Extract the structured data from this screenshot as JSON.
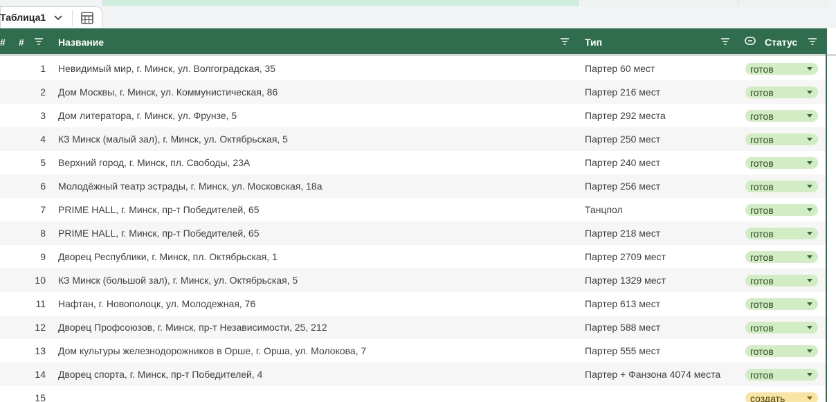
{
  "sheet_tab": {
    "name": "Таблица1"
  },
  "columns": {
    "hash1": "#",
    "hash2": "#",
    "name": "Название",
    "type": "Тип",
    "status": "Статус"
  },
  "rows": [
    {
      "num": "1",
      "name": "Невидимый мир, г. Минск, ул. Волгоградская, 35",
      "type": "Партер 60 мест",
      "status": "готов"
    },
    {
      "num": "2",
      "name": "Дом Москвы, г. Минск, ул. Коммунистическая, 86",
      "type": "Партер 216 мест",
      "status": "готов"
    },
    {
      "num": "3",
      "name": "Дом литератора, г. Минск, ул. Фрунзе, 5",
      "type": "Партер 292 места",
      "status": "готов"
    },
    {
      "num": "4",
      "name": "КЗ Минск (малый зал), г. Минск, ул. Октябрьская, 5",
      "type": "Партер 250 мест",
      "status": "готов"
    },
    {
      "num": "5",
      "name": "Верхний город, г. Минск, пл. Свободы, 23А",
      "type": "Партер 240 мест",
      "status": "готов"
    },
    {
      "num": "6",
      "name": "Молодёжный театр эстрады, г. Минск, ул. Московская, 18а",
      "type": "Партер 256 мест",
      "status": "готов"
    },
    {
      "num": "7",
      "name": "PRIME HALL, г. Минск, пр-т Победителей, 65",
      "type": "Танцпол",
      "status": "готов"
    },
    {
      "num": "8",
      "name": "PRIME HALL, г. Минск, пр-т Победителей, 65",
      "type": "Партер 218 мест",
      "status": "готов"
    },
    {
      "num": "9",
      "name": "Дворец Республики, г. Минск, пл. Октябрьская, 1",
      "type": "Партер 2709 мест",
      "status": "готов"
    },
    {
      "num": "10",
      "name": "КЗ Минск (большой зал), г. Минск, ул. Октябрьская, 5",
      "type": "Партер 1329 мест",
      "status": "готов"
    },
    {
      "num": "11",
      "name": "Нафтан, г. Новополоцк, ул. Молодежная, 76",
      "type": "Партер 613 мест",
      "status": "готов"
    },
    {
      "num": "12",
      "name": "Дворец Профсоюзов, г. Минск, пр-т Независимости, 25, 212",
      "type": "Партер 588 мест",
      "status": "готов"
    },
    {
      "num": "13",
      "name": "Дом культуры железнодорожников в Орше, г. Орша, ул. Молокова, 7",
      "type": "Партер 555 мест",
      "status": "готов"
    },
    {
      "num": "14",
      "name": "Дворец спорта, г. Минск, пр-т Победителей, 4",
      "type": "Партер + Фанзона 4074 места",
      "status": "готов"
    },
    {
      "num": "15",
      "name": "",
      "type": "",
      "status": "создать"
    }
  ],
  "colors": {
    "header_bg": "#2f6d4e",
    "pill_ready": "#d2ecc4",
    "pill_create": "#f9e5a3",
    "alt_row": "#f5f6f5"
  },
  "icons": [
    "chevron-down-icon",
    "table-icon",
    "filter-icon",
    "status-icon",
    "dropdown-caret-icon"
  ]
}
